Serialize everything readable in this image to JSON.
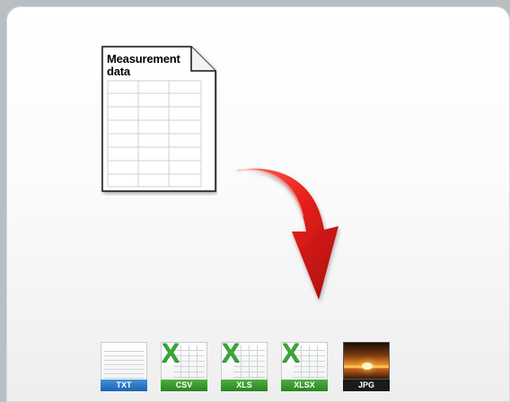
{
  "document": {
    "title_line1": "Measurement",
    "title_line2": "data",
    "icon": "spreadsheet-document-icon"
  },
  "arrow": {
    "icon": "red-curved-arrow-icon",
    "color": "#e8201c"
  },
  "formats": [
    {
      "label": "TXT",
      "icon": "txt-file-icon",
      "color": "#2a74c8"
    },
    {
      "label": "CSV",
      "icon": "csv-file-icon",
      "color": "#37952c"
    },
    {
      "label": "XLS",
      "icon": "xls-file-icon",
      "color": "#37952c"
    },
    {
      "label": "XLSX",
      "icon": "xlsx-file-icon",
      "color": "#37952c"
    },
    {
      "label": "JPG",
      "icon": "jpg-file-icon",
      "color": "#1a1a1a"
    }
  ],
  "excel_mark": "X"
}
